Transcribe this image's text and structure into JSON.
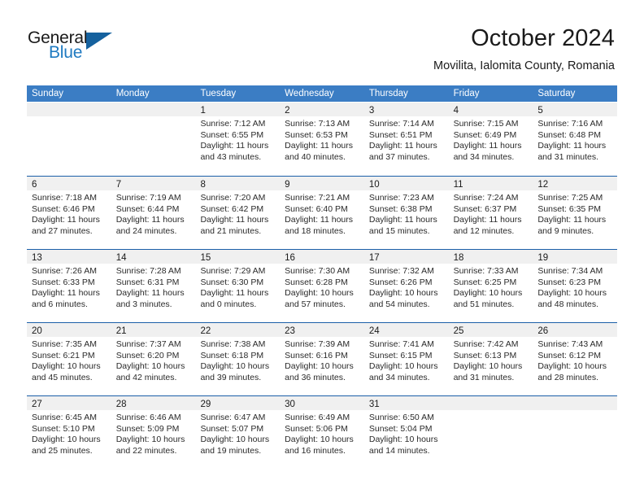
{
  "brand": {
    "name_part1": "General",
    "name_part2": "Blue",
    "triangle_color": "#15619e",
    "blue_text_color": "#1f7ac1"
  },
  "header": {
    "title": "October 2024",
    "subtitle": "Movilita, Ialomita County, Romania"
  },
  "theme": {
    "header_row_bg": "#3b7dc4",
    "row_separator": "#1b5fa8",
    "day_band_bg": "#f0f0f0",
    "text_color": "#1a1a1a"
  },
  "weekdays": [
    "Sunday",
    "Monday",
    "Tuesday",
    "Wednesday",
    "Thursday",
    "Friday",
    "Saturday"
  ],
  "calendar_data": {
    "month": "October",
    "year": 2024,
    "location": "Movilita, Ialomita County, Romania",
    "week_start": "Sunday",
    "weeks": [
      [
        {
          "day": "",
          "lines": []
        },
        {
          "day": "",
          "lines": []
        },
        {
          "day": "1",
          "lines": [
            "Sunrise: 7:12 AM",
            "Sunset: 6:55 PM",
            "Daylight: 11 hours",
            "and 43 minutes."
          ]
        },
        {
          "day": "2",
          "lines": [
            "Sunrise: 7:13 AM",
            "Sunset: 6:53 PM",
            "Daylight: 11 hours",
            "and 40 minutes."
          ]
        },
        {
          "day": "3",
          "lines": [
            "Sunrise: 7:14 AM",
            "Sunset: 6:51 PM",
            "Daylight: 11 hours",
            "and 37 minutes."
          ]
        },
        {
          "day": "4",
          "lines": [
            "Sunrise: 7:15 AM",
            "Sunset: 6:49 PM",
            "Daylight: 11 hours",
            "and 34 minutes."
          ]
        },
        {
          "day": "5",
          "lines": [
            "Sunrise: 7:16 AM",
            "Sunset: 6:48 PM",
            "Daylight: 11 hours",
            "and 31 minutes."
          ]
        }
      ],
      [
        {
          "day": "6",
          "lines": [
            "Sunrise: 7:18 AM",
            "Sunset: 6:46 PM",
            "Daylight: 11 hours",
            "and 27 minutes."
          ]
        },
        {
          "day": "7",
          "lines": [
            "Sunrise: 7:19 AM",
            "Sunset: 6:44 PM",
            "Daylight: 11 hours",
            "and 24 minutes."
          ]
        },
        {
          "day": "8",
          "lines": [
            "Sunrise: 7:20 AM",
            "Sunset: 6:42 PM",
            "Daylight: 11 hours",
            "and 21 minutes."
          ]
        },
        {
          "day": "9",
          "lines": [
            "Sunrise: 7:21 AM",
            "Sunset: 6:40 PM",
            "Daylight: 11 hours",
            "and 18 minutes."
          ]
        },
        {
          "day": "10",
          "lines": [
            "Sunrise: 7:23 AM",
            "Sunset: 6:38 PM",
            "Daylight: 11 hours",
            "and 15 minutes."
          ]
        },
        {
          "day": "11",
          "lines": [
            "Sunrise: 7:24 AM",
            "Sunset: 6:37 PM",
            "Daylight: 11 hours",
            "and 12 minutes."
          ]
        },
        {
          "day": "12",
          "lines": [
            "Sunrise: 7:25 AM",
            "Sunset: 6:35 PM",
            "Daylight: 11 hours",
            "and 9 minutes."
          ]
        }
      ],
      [
        {
          "day": "13",
          "lines": [
            "Sunrise: 7:26 AM",
            "Sunset: 6:33 PM",
            "Daylight: 11 hours",
            "and 6 minutes."
          ]
        },
        {
          "day": "14",
          "lines": [
            "Sunrise: 7:28 AM",
            "Sunset: 6:31 PM",
            "Daylight: 11 hours",
            "and 3 minutes."
          ]
        },
        {
          "day": "15",
          "lines": [
            "Sunrise: 7:29 AM",
            "Sunset: 6:30 PM",
            "Daylight: 11 hours",
            "and 0 minutes."
          ]
        },
        {
          "day": "16",
          "lines": [
            "Sunrise: 7:30 AM",
            "Sunset: 6:28 PM",
            "Daylight: 10 hours",
            "and 57 minutes."
          ]
        },
        {
          "day": "17",
          "lines": [
            "Sunrise: 7:32 AM",
            "Sunset: 6:26 PM",
            "Daylight: 10 hours",
            "and 54 minutes."
          ]
        },
        {
          "day": "18",
          "lines": [
            "Sunrise: 7:33 AM",
            "Sunset: 6:25 PM",
            "Daylight: 10 hours",
            "and 51 minutes."
          ]
        },
        {
          "day": "19",
          "lines": [
            "Sunrise: 7:34 AM",
            "Sunset: 6:23 PM",
            "Daylight: 10 hours",
            "and 48 minutes."
          ]
        }
      ],
      [
        {
          "day": "20",
          "lines": [
            "Sunrise: 7:35 AM",
            "Sunset: 6:21 PM",
            "Daylight: 10 hours",
            "and 45 minutes."
          ]
        },
        {
          "day": "21",
          "lines": [
            "Sunrise: 7:37 AM",
            "Sunset: 6:20 PM",
            "Daylight: 10 hours",
            "and 42 minutes."
          ]
        },
        {
          "day": "22",
          "lines": [
            "Sunrise: 7:38 AM",
            "Sunset: 6:18 PM",
            "Daylight: 10 hours",
            "and 39 minutes."
          ]
        },
        {
          "day": "23",
          "lines": [
            "Sunrise: 7:39 AM",
            "Sunset: 6:16 PM",
            "Daylight: 10 hours",
            "and 36 minutes."
          ]
        },
        {
          "day": "24",
          "lines": [
            "Sunrise: 7:41 AM",
            "Sunset: 6:15 PM",
            "Daylight: 10 hours",
            "and 34 minutes."
          ]
        },
        {
          "day": "25",
          "lines": [
            "Sunrise: 7:42 AM",
            "Sunset: 6:13 PM",
            "Daylight: 10 hours",
            "and 31 minutes."
          ]
        },
        {
          "day": "26",
          "lines": [
            "Sunrise: 7:43 AM",
            "Sunset: 6:12 PM",
            "Daylight: 10 hours",
            "and 28 minutes."
          ]
        }
      ],
      [
        {
          "day": "27",
          "lines": [
            "Sunrise: 6:45 AM",
            "Sunset: 5:10 PM",
            "Daylight: 10 hours",
            "and 25 minutes."
          ]
        },
        {
          "day": "28",
          "lines": [
            "Sunrise: 6:46 AM",
            "Sunset: 5:09 PM",
            "Daylight: 10 hours",
            "and 22 minutes."
          ]
        },
        {
          "day": "29",
          "lines": [
            "Sunrise: 6:47 AM",
            "Sunset: 5:07 PM",
            "Daylight: 10 hours",
            "and 19 minutes."
          ]
        },
        {
          "day": "30",
          "lines": [
            "Sunrise: 6:49 AM",
            "Sunset: 5:06 PM",
            "Daylight: 10 hours",
            "and 16 minutes."
          ]
        },
        {
          "day": "31",
          "lines": [
            "Sunrise: 6:50 AM",
            "Sunset: 5:04 PM",
            "Daylight: 10 hours",
            "and 14 minutes."
          ]
        },
        {
          "day": "",
          "lines": []
        },
        {
          "day": "",
          "lines": []
        }
      ]
    ]
  }
}
